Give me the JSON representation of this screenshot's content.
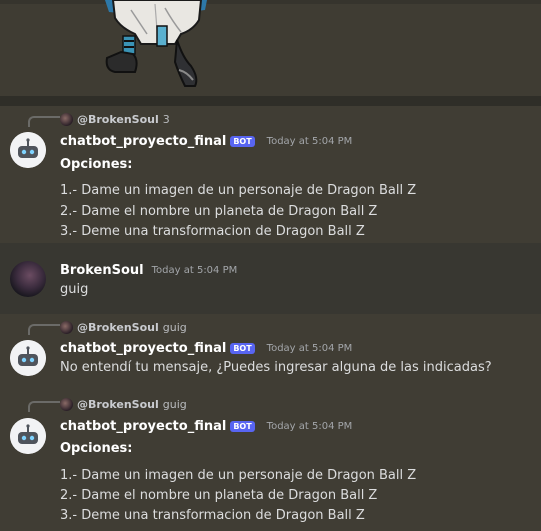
{
  "colors": {
    "background": "#3f3c33",
    "bot_tag": "#5865f2",
    "username": "#ffffff",
    "text": "#dcddde"
  },
  "messages": [
    {
      "reply_user": "@BrokenSoul",
      "reply_text": "3",
      "author": "chatbot_proyecto_final",
      "tag": "BOT",
      "time": "Today at 5:04 PM",
      "heading": "Opciones:",
      "lines": [
        "1.- Dame un imagen de un personaje de Dragon Ball Z",
        "2.- Dame el nombre un planeta de Dragon Ball Z",
        "3.- Deme una transformacion de Dragon Ball Z"
      ]
    },
    {
      "author": "BrokenSoul",
      "time": "Today at 5:04 PM",
      "text": "guig"
    },
    {
      "reply_user": "@BrokenSoul",
      "reply_text": "guig",
      "author": "chatbot_proyecto_final",
      "tag": "BOT",
      "time": "Today at 5:04 PM",
      "text": "No entendí tu mensaje, ¿Puedes ingresar alguna de las indicadas?"
    },
    {
      "reply_user": "@BrokenSoul",
      "reply_text": "guig",
      "author": "chatbot_proyecto_final",
      "tag": "BOT",
      "time": "Today at 5:04 PM",
      "heading": "Opciones:",
      "lines": [
        "1.- Dame un imagen de un personaje de Dragon Ball Z",
        "2.- Dame el nombre un planeta de Dragon Ball Z",
        "3.- Deme una transformacion de Dragon Ball Z"
      ]
    }
  ]
}
